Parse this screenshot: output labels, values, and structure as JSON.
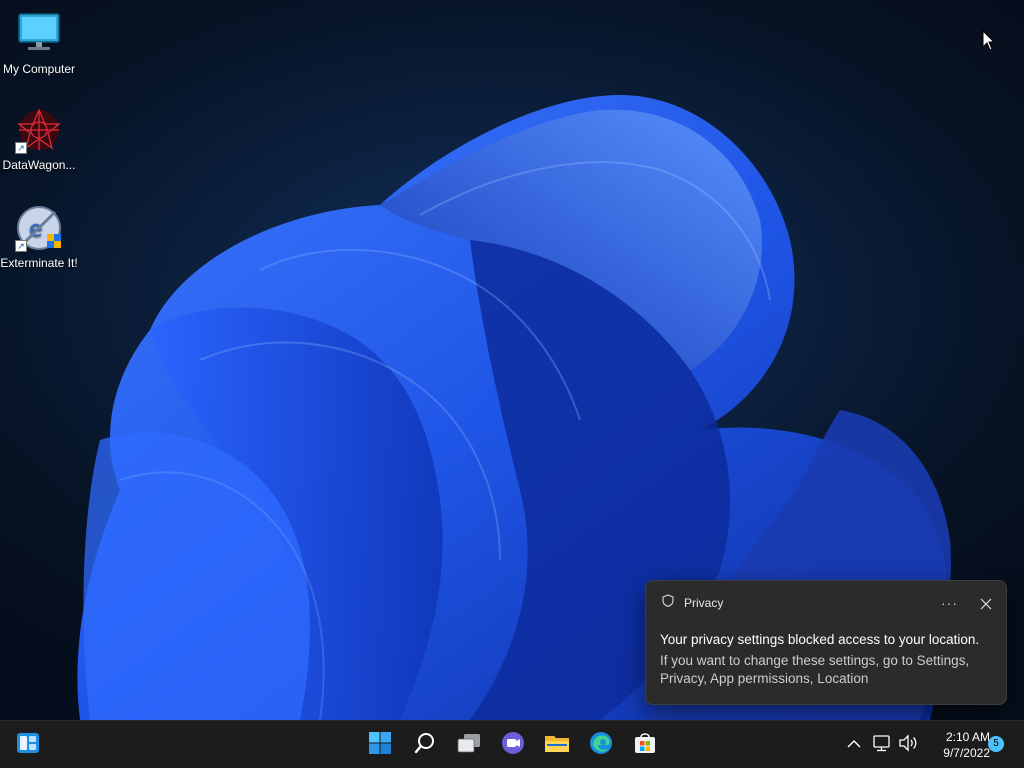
{
  "desktop": {
    "icons": [
      {
        "label": "My Computer",
        "icon": "monitor-icon"
      },
      {
        "label": "DataWagon...",
        "icon": "datawagon-icon"
      },
      {
        "label": "Exterminate It!",
        "icon": "exterminate-it-icon"
      }
    ]
  },
  "toast": {
    "app_name": "Privacy",
    "more_label": "···",
    "title": "Your privacy settings blocked access to your location.",
    "body": "If you want to change these settings, go to Settings, Privacy, App permissions, Location"
  },
  "taskbar": {
    "widgets": "widgets-icon",
    "apps": [
      "start-icon",
      "search-icon",
      "task-view-icon",
      "teams-chat-icon",
      "file-explorer-icon",
      "edge-icon",
      "store-icon"
    ],
    "tray": {
      "time": "2:10 AM",
      "date": "9/7/2022",
      "notification_count": "5"
    }
  },
  "colors": {
    "accent": "#4cc2ff",
    "taskbar": "#1c1c1c",
    "toast": "#2b2b2b"
  }
}
